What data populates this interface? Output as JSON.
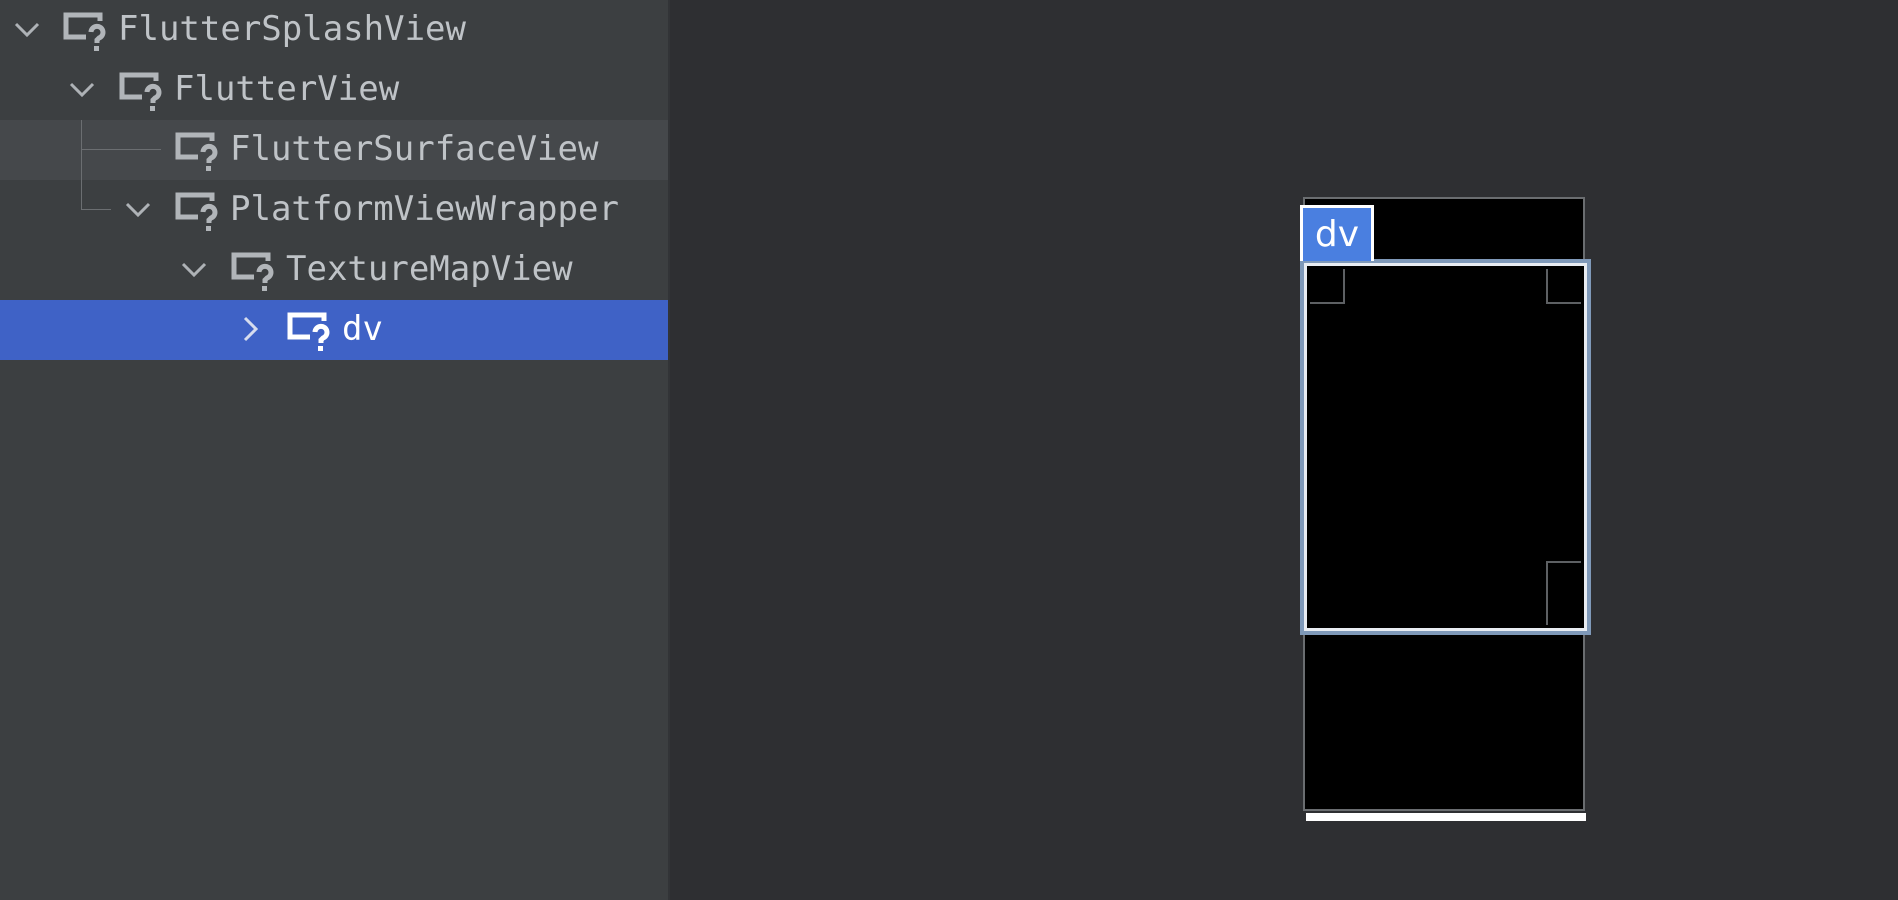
{
  "tree": {
    "nodes": [
      {
        "label": "FlutterSplashView",
        "expanded": true,
        "icon": "unknown-view-icon"
      },
      {
        "label": "FlutterView",
        "expanded": true,
        "icon": "unknown-view-icon"
      },
      {
        "label": "FlutterSurfaceView",
        "icon": "unknown-view-icon"
      },
      {
        "label": "PlatformViewWrapper",
        "expanded": true,
        "icon": "unknown-view-icon"
      },
      {
        "label": "TextureMapView",
        "expanded": true,
        "icon": "unknown-view-icon"
      },
      {
        "label": "dv",
        "expanded": false,
        "selected": true,
        "icon": "unknown-view-icon"
      }
    ]
  },
  "preview": {
    "selected_label": "dv",
    "colors": {
      "tag": "#4a7fe0",
      "selection_border": "#7f99b9",
      "tree_selection": "#3f62c6"
    }
  }
}
